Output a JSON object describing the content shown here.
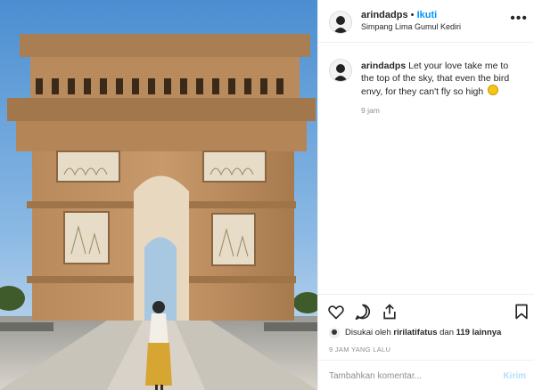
{
  "header": {
    "username": "arindadps",
    "separator": "•",
    "follow_label": "Ikuti",
    "location": "Simpang Lima Gumul Kediri",
    "more_icon": "more-horizontal-icon"
  },
  "caption": {
    "username": "arindadps",
    "text": "Let your love take me to the top of the sky, that even the bird envy, for they can't fly so high",
    "time": "9 jam"
  },
  "actions": {
    "like_icon": "heart-icon",
    "comment_icon": "comment-icon",
    "share_icon": "share-icon",
    "save_icon": "bookmark-icon"
  },
  "likes": {
    "text_prefix": "Disukai oleh ",
    "liker": "ririlatifatus",
    "text_middle": " dan ",
    "count": "119 lainnya"
  },
  "timestamp": "9 JAM YANG LALU",
  "comment_box": {
    "placeholder": "Tambahkan komentar...",
    "send_label": "Kirim"
  }
}
